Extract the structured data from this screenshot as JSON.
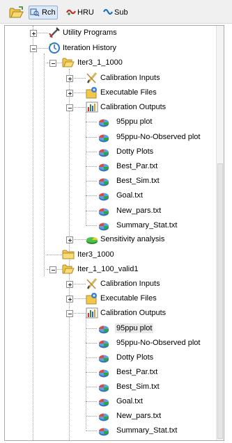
{
  "toolbar": {
    "rch_label": "Rch",
    "hru_label": "HRU",
    "sub_label": "Sub"
  },
  "tree": {
    "utility_programs": "Utility Programs",
    "iteration_history": "Iteration History",
    "iter3_1_1000": {
      "label": "Iter3_1_1000",
      "calibration_inputs": "Calibration Inputs",
      "executable_files": "Executable Files",
      "calibration_outputs": "Calibration Outputs",
      "outputs": [
        "95ppu plot",
        "95ppu-No-Observed plot",
        "Dotty Plots",
        "Best_Par.txt",
        "Best_Sim.txt",
        "Goal.txt",
        "New_pars.txt",
        "Summary_Stat.txt"
      ],
      "sensitivity_analysis": "Sensitivity analysis"
    },
    "iter3_1000": "Iter3_1000",
    "iter_1_100_valid1": {
      "label": "Iter_1_100_valid1",
      "calibration_inputs": "Calibration Inputs",
      "executable_files": "Executable Files",
      "calibration_outputs": "Calibration Outputs",
      "outputs": [
        "95ppu plot",
        "95ppu-No-Observed plot",
        "Dotty Plots",
        "Best_Par.txt",
        "Best_Sim.txt",
        "Goal.txt",
        "New_pars.txt",
        "Summary_Stat.txt"
      ],
      "selected_output": "95ppu plot"
    }
  }
}
